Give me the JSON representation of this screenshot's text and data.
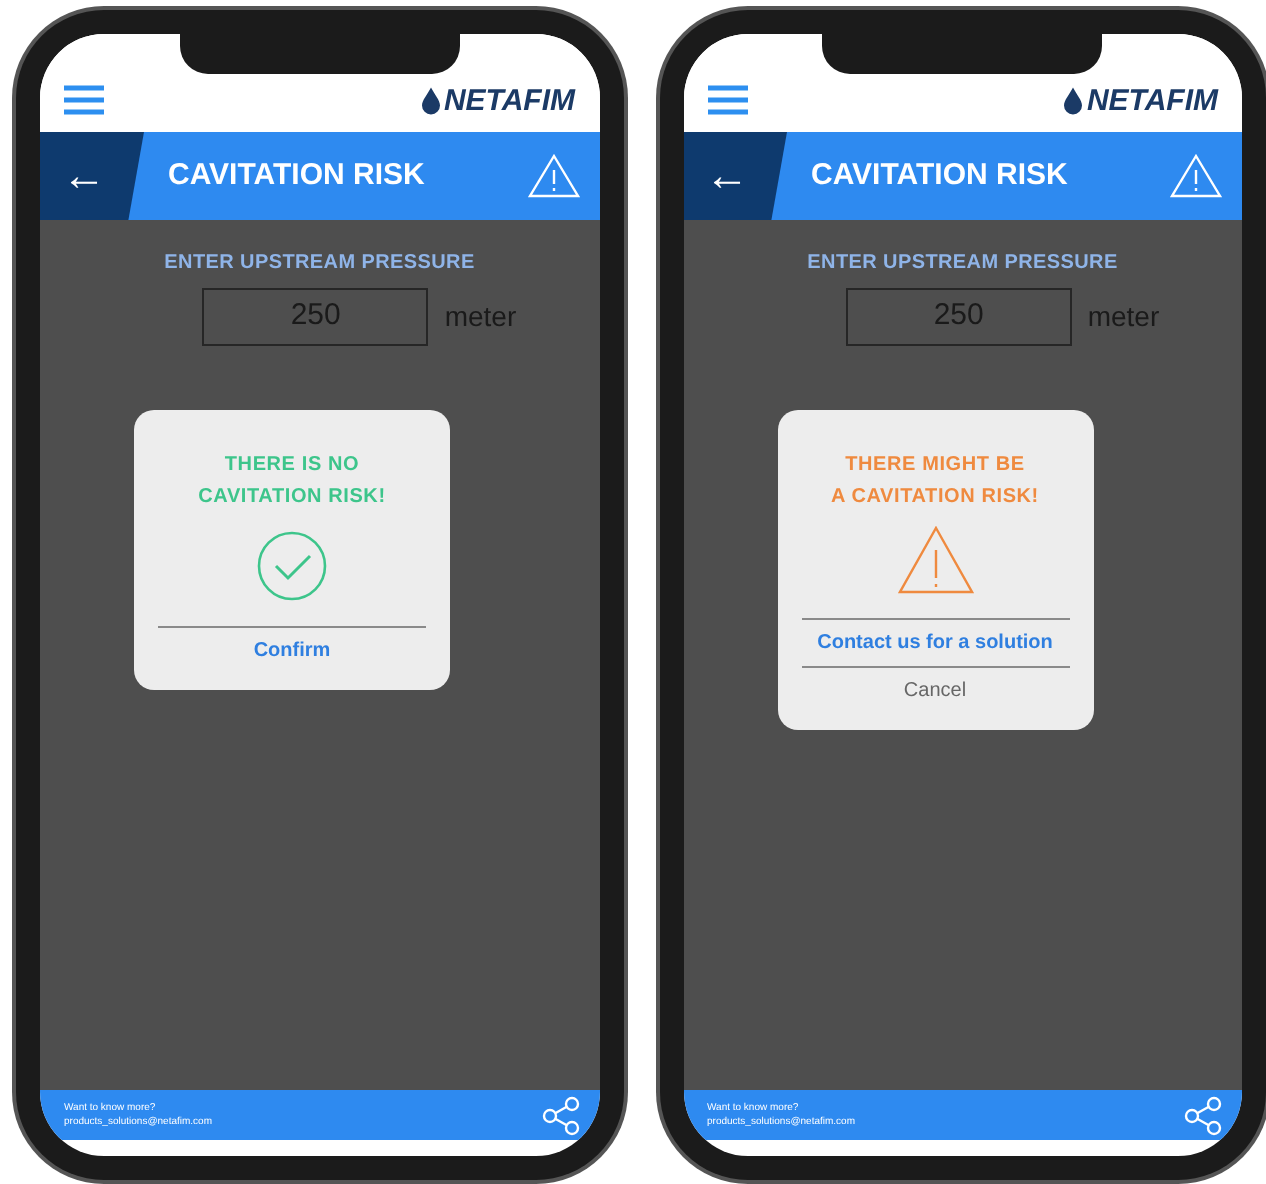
{
  "phones": [
    {
      "header": {
        "logo": "NETAFIM"
      },
      "title_bar": {
        "back": "←",
        "title": "CAVITATION RISK"
      },
      "form": {
        "label": "ENTER UPSTREAM PRESSURE",
        "value": "250",
        "unit": "meter"
      },
      "dialog": {
        "kind": "ok",
        "message_lines": [
          "THERE IS NO",
          "CAVITATION RISK!"
        ],
        "actions": [
          {
            "label": "Confirm",
            "kind": "primary"
          }
        ]
      },
      "footer": {
        "lines": [
          "Want to know more?",
          "products_solutions@netafim.com"
        ]
      }
    },
    {
      "header": {
        "logo": "NETAFIM"
      },
      "title_bar": {
        "back": "←",
        "title": "CAVITATION RISK"
      },
      "form": {
        "label": "ENTER UPSTREAM PRESSURE",
        "value": "250",
        "unit": "meter"
      },
      "dialog": {
        "kind": "risk",
        "message_lines": [
          "THERE MIGHT BE",
          "A CAVITATION RISK!"
        ],
        "actions": [
          {
            "label": "Contact us for a solution",
            "kind": "primary"
          },
          {
            "label": "Cancel",
            "kind": "secondary"
          }
        ]
      },
      "footer": {
        "lines": [
          "Want to know more?",
          "products_solutions@netafim.com"
        ]
      }
    }
  ]
}
